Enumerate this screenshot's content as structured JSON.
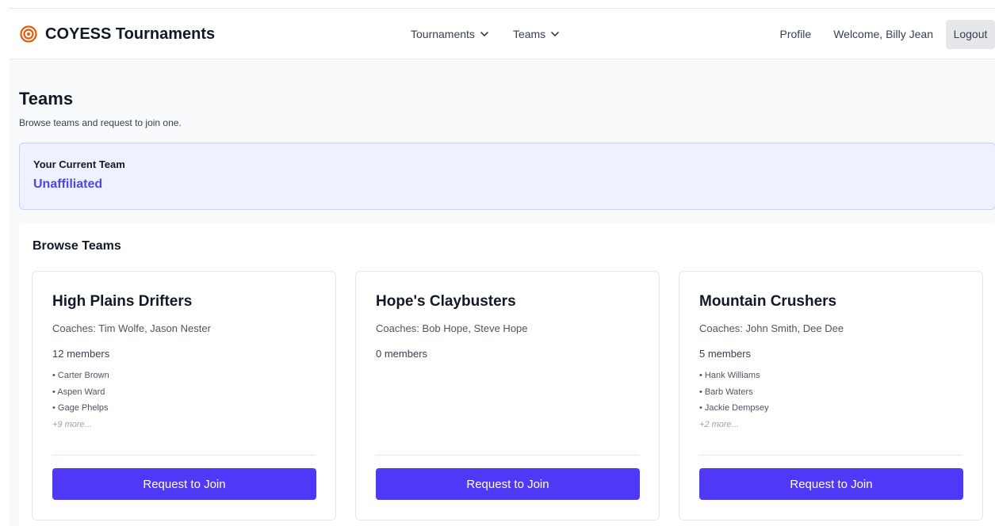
{
  "header": {
    "brand": "COYESS Tournaments",
    "brand_icon": "target-icon",
    "nav": [
      {
        "label": "Tournaments"
      },
      {
        "label": "Teams"
      }
    ],
    "profile": "Profile",
    "welcome": "Welcome, Billy Jean",
    "logout": "Logout"
  },
  "page": {
    "title": "Teams",
    "subtitle": "Browse teams and request to join one."
  },
  "current_team": {
    "label": "Your Current Team",
    "value": "Unaffiliated"
  },
  "browse": {
    "title": "Browse Teams",
    "teams": [
      {
        "name": "High Plains Drifters",
        "coaches": "Coaches: Tim Wolfe, Jason Nester",
        "members_count": "12 members",
        "members": [
          "• Carter Brown",
          "• Aspen Ward",
          "• Gage Phelps"
        ],
        "more": "+9 more...",
        "button": "Request to Join"
      },
      {
        "name": "Hope's Claybusters",
        "coaches": "Coaches: Bob Hope, Steve Hope",
        "members_count": "0 members",
        "members": [],
        "more": "",
        "button": "Request to Join"
      },
      {
        "name": "Mountain Crushers",
        "coaches": "Coaches: John Smith, Dee Dee",
        "members_count": "5 members",
        "members": [
          "• Hank Williams",
          "• Barb Waters",
          "• Jackie Dempsey"
        ],
        "more": "+2 more...",
        "button": "Request to Join"
      }
    ]
  },
  "colors": {
    "accent": "#4f39f6",
    "brand_icon": "#ea580c",
    "current_team_bg": "#eef2ff",
    "current_team_value": "#4f46e5"
  }
}
